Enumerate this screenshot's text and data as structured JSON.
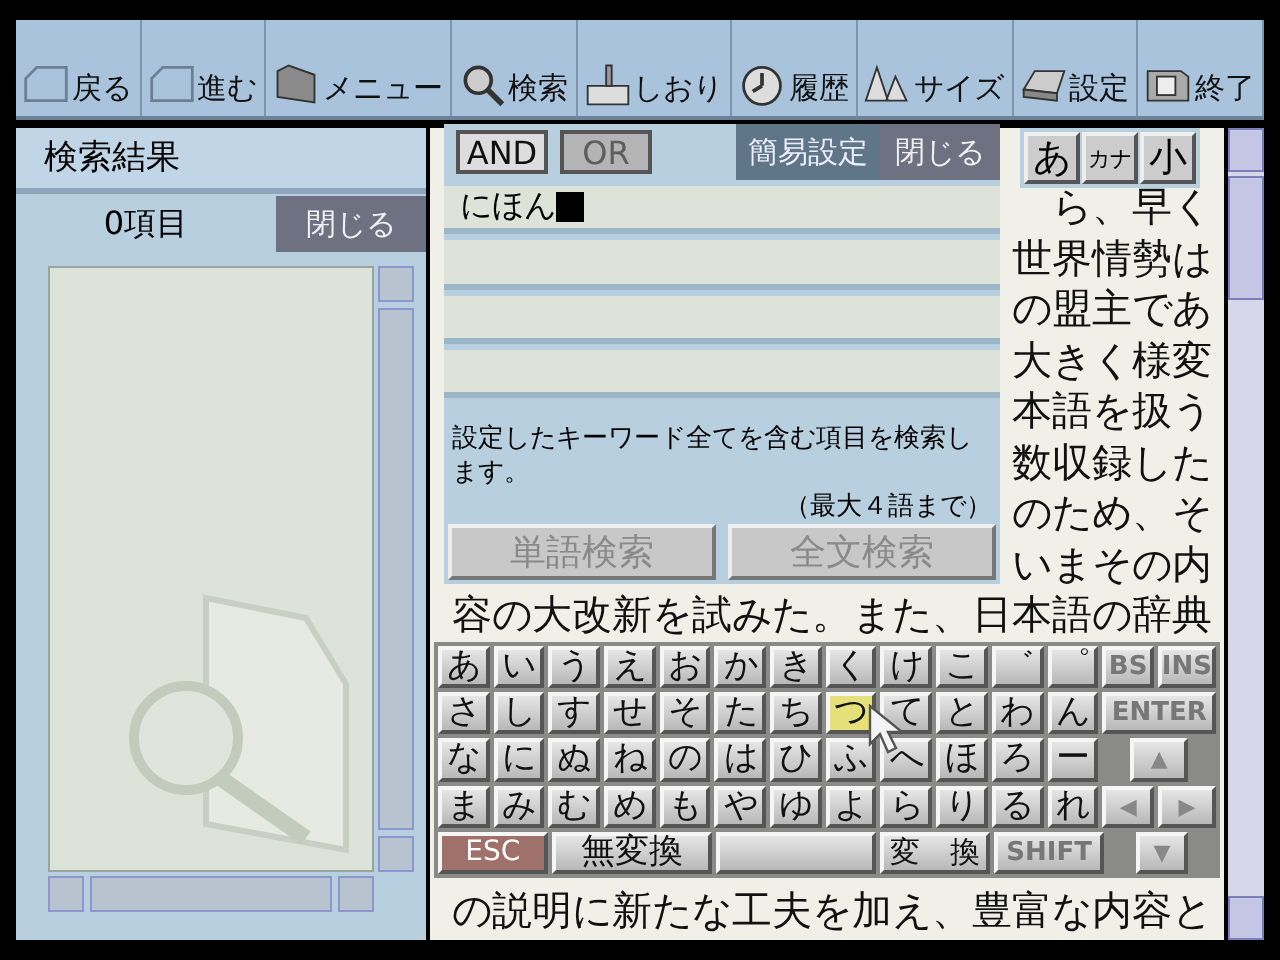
{
  "toolbar": [
    {
      "label": "戻る"
    },
    {
      "label": "進む"
    },
    {
      "label": "メニュー"
    },
    {
      "label": "検索"
    },
    {
      "label": "しおり"
    },
    {
      "label": "履歴"
    },
    {
      "label": "サイズ"
    },
    {
      "label": "設定"
    },
    {
      "label": "終了"
    }
  ],
  "results_panel": {
    "title": "検索結果",
    "count": "0項目",
    "close_button": "閉じる"
  },
  "search_panel": {
    "modes": [
      {
        "label": "AND",
        "selected": true
      },
      {
        "label": "OR",
        "selected": false
      }
    ],
    "settings_tab": "簡易設定",
    "close_button": "閉じる",
    "fields": [
      {
        "value": "にほん",
        "focused": true
      },
      {
        "focused": false
      },
      {
        "focused": false
      },
      {
        "focused": false
      }
    ],
    "hint": "設定したキーワード全てを含む項目を検索します。",
    "hint_note": "（最大４語まで）",
    "buttons": [
      {
        "label": "単語検索",
        "disabled": true
      },
      {
        "label": "全文検索",
        "disabled": true
      }
    ]
  },
  "input_modes": [
    {
      "label": "あ"
    },
    {
      "label": "カナ"
    },
    {
      "label": "小"
    }
  ],
  "reader": {
    "lines": [
      "ら、早く",
      "世界情勢は",
      "の盟主であ",
      "大きく様変",
      "本語を扱う",
      "数収録した",
      "のため、そ",
      "いまその内",
      "容の大改新を試みた。また、日本語の辞典"
    ],
    "last_line": "の説明に新たな工夫を加え、豊富な内容と"
  },
  "keyboard": {
    "rows": [
      [
        {
          "label": "あ",
          "kind": "kana",
          "selected": false
        },
        {
          "label": "い",
          "kind": "kana",
          "selected": false
        },
        {
          "label": "う",
          "kind": "kana",
          "selected": false
        },
        {
          "label": "え",
          "kind": "kana",
          "selected": false
        },
        {
          "label": "お",
          "kind": "kana",
          "selected": false
        },
        {
          "label": "か",
          "kind": "kana",
          "selected": false
        },
        {
          "label": "き",
          "kind": "kana",
          "selected": false
        },
        {
          "label": "く",
          "kind": "kana",
          "selected": false
        },
        {
          "label": "け",
          "kind": "kana",
          "selected": false
        },
        {
          "label": "こ",
          "kind": "kana",
          "selected": false
        },
        {
          "label": "゛",
          "kind": "kana",
          "selected": false
        },
        {
          "label": "゜",
          "kind": "kana",
          "selected": false
        },
        {
          "label": "BS",
          "kind": "func",
          "selected": false
        },
        {
          "label": "INS",
          "kind": "func",
          "selected": false
        }
      ],
      [
        {
          "label": "さ",
          "kind": "kana",
          "selected": false
        },
        {
          "label": "し",
          "kind": "kana",
          "selected": false
        },
        {
          "label": "す",
          "kind": "kana",
          "selected": false
        },
        {
          "label": "せ",
          "kind": "kana",
          "selected": false
        },
        {
          "label": "そ",
          "kind": "kana",
          "selected": false
        },
        {
          "label": "た",
          "kind": "kana",
          "selected": false
        },
        {
          "label": "ち",
          "kind": "kana",
          "selected": false
        },
        {
          "label": "つ",
          "kind": "kana",
          "selected": true
        },
        {
          "label": "て",
          "kind": "kana",
          "selected": false
        },
        {
          "label": "と",
          "kind": "kana",
          "selected": false
        },
        {
          "label": "わ",
          "kind": "kana",
          "selected": false
        },
        {
          "label": "ん",
          "kind": "kana",
          "selected": false
        },
        {
          "label": "ENTER",
          "kind": "enter",
          "selected": false
        }
      ],
      [
        {
          "label": "な",
          "kind": "kana",
          "selected": false
        },
        {
          "label": "に",
          "kind": "kana",
          "selected": false
        },
        {
          "label": "ぬ",
          "kind": "kana",
          "selected": false
        },
        {
          "label": "ね",
          "kind": "kana",
          "selected": false
        },
        {
          "label": "の",
          "kind": "kana",
          "selected": false
        },
        {
          "label": "は",
          "kind": "kana",
          "selected": false
        },
        {
          "label": "ひ",
          "kind": "kana",
          "selected": false
        },
        {
          "label": "ふ",
          "kind": "kana",
          "selected": false
        },
        {
          "label": "へ",
          "kind": "kana",
          "selected": false
        },
        {
          "label": "ほ",
          "kind": "kana",
          "selected": false
        },
        {
          "label": "ろ",
          "kind": "kana",
          "selected": false
        },
        {
          "label": "ー",
          "kind": "kana",
          "selected": false
        },
        {
          "label": "▲",
          "kind": "arrow-wide",
          "selected": false
        }
      ],
      [
        {
          "label": "ま",
          "kind": "kana",
          "selected": false
        },
        {
          "label": "み",
          "kind": "kana",
          "selected": false
        },
        {
          "label": "む",
          "kind": "kana",
          "selected": false
        },
        {
          "label": "め",
          "kind": "kana",
          "selected": false
        },
        {
          "label": "も",
          "kind": "kana",
          "selected": false
        },
        {
          "label": "や",
          "kind": "kana",
          "selected": false
        },
        {
          "label": "ゆ",
          "kind": "kana",
          "selected": false
        },
        {
          "label": "よ",
          "kind": "kana",
          "selected": false
        },
        {
          "label": "ら",
          "kind": "kana",
          "selected": false
        },
        {
          "label": "り",
          "kind": "kana",
          "selected": false
        },
        {
          "label": "る",
          "kind": "kana",
          "selected": false
        },
        {
          "label": "れ",
          "kind": "kana",
          "selected": false
        },
        {
          "label": "◀",
          "kind": "arrow",
          "selected": false
        },
        {
          "label": "▶",
          "kind": "arrow",
          "selected": false
        }
      ]
    ],
    "bottom_row": [
      {
        "label": "ESC",
        "kind": "escape",
        "selected": false
      },
      {
        "label": "無変換",
        "kind": "long",
        "selected": false
      },
      {
        "kind": "space",
        "selected": false
      },
      {
        "label": "変　換",
        "kind": "convert",
        "selected": false
      },
      {
        "label": "SHIFT",
        "kind": "shift",
        "selected": false
      },
      {
        "label": "▼",
        "kind": "arrow-wide",
        "selected": false
      }
    ]
  }
}
